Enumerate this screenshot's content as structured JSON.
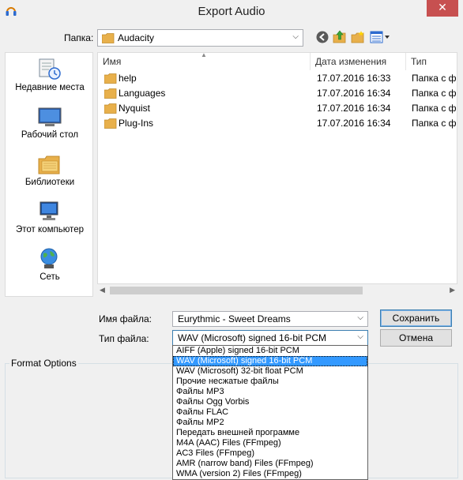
{
  "window": {
    "title": "Export Audio",
    "close_label": "✕"
  },
  "location": {
    "label": "Папка:",
    "value": "Audacity"
  },
  "places": [
    {
      "label": "Недавние места"
    },
    {
      "label": "Рабочий стол"
    },
    {
      "label": "Библиотеки"
    },
    {
      "label": "Этот компьютер"
    },
    {
      "label": "Сеть"
    }
  ],
  "columns": {
    "name": "Имя",
    "date": "Дата изменения",
    "type": "Тип"
  },
  "files": [
    {
      "name": "help",
      "date": "17.07.2016 16:33",
      "type": "Папка с ф"
    },
    {
      "name": "Languages",
      "date": "17.07.2016 16:34",
      "type": "Папка с ф"
    },
    {
      "name": "Nyquist",
      "date": "17.07.2016 16:34",
      "type": "Папка с ф"
    },
    {
      "name": "Plug-Ins",
      "date": "17.07.2016 16:34",
      "type": "Папка с ф"
    }
  ],
  "filename": {
    "label": "Имя файла:",
    "value": "Eurythmic - Sweet Dreams"
  },
  "filetype": {
    "label": "Тип файла:",
    "value": "WAV (Microsoft) signed 16-bit PCM"
  },
  "buttons": {
    "save": "Сохранить",
    "cancel": "Отмена"
  },
  "format_options": {
    "title": "Format Options"
  },
  "filetype_options": [
    "AIFF (Apple) signed 16-bit PCM",
    "WAV (Microsoft) signed 16-bit PCM",
    "WAV (Microsoft) 32-bit float PCM",
    "Прочие несжатые файлы",
    "Файлы MP3",
    "Файлы Ogg Vorbis",
    "Файлы FLAC",
    "Файлы MP2",
    "Передать внешней программе",
    "M4A (AAC) Files (FFmpeg)",
    "AC3 Files (FFmpeg)",
    "AMR (narrow band) Files (FFmpeg)",
    "WMA (version 2) Files (FFmpeg)"
  ],
  "selected_filetype_index": 1,
  "colors": {
    "selection": "#3399ff",
    "folder": "#e8b04b",
    "close": "#c75050"
  }
}
